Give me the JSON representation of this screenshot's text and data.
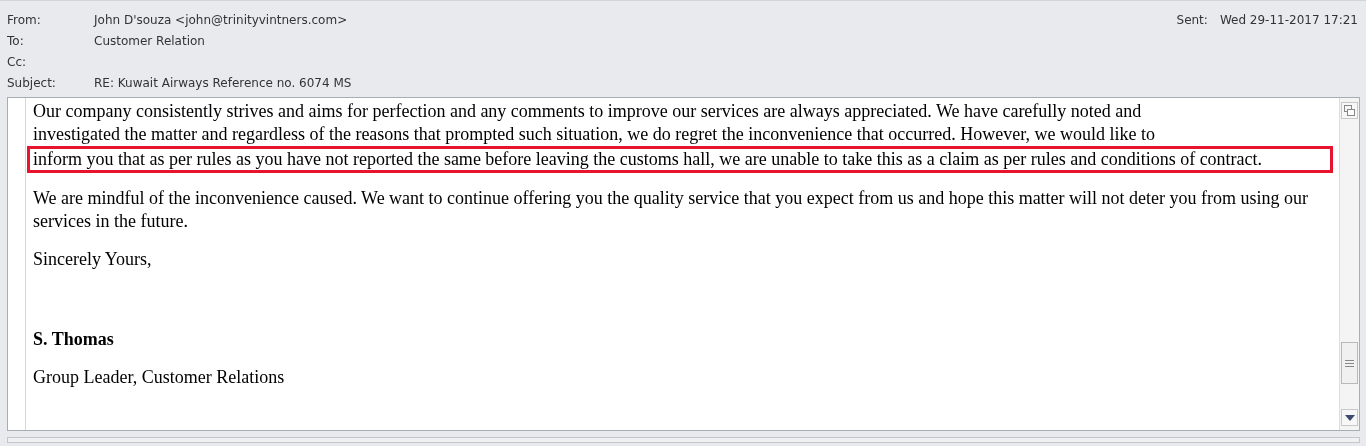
{
  "header": {
    "fields": [
      {
        "label": "From:",
        "value": "John D'souza <john@trinityvintners.com>"
      },
      {
        "label": "To:",
        "value": "Customer Relation"
      },
      {
        "label": "Cc:"
      },
      {
        "label": "Subject:",
        "value": "RE: Kuwait Airways Reference no. 6074 MS"
      }
    ],
    "sent": {
      "label": "Sent:",
      "value": "Wed 29-11-2017 17:21"
    }
  },
  "body": {
    "blocks": [
      {
        "kind": "lines",
        "lines": [
          {
            "text": "Our company consistently strives and aims for perfection and any comments to improve our services are always appreciated. We have carefully noted and",
            "highlighted": false
          },
          {
            "text": "investigated the matter and regardless of the reasons that prompted such situation, we do regret the inconvenience that occurred. However, we would like to",
            "highlighted": false
          },
          {
            "text": "inform you that as per rules as you have not reported the same before leaving the customs hall, we are unable to take this as a claim as per rules and conditions of contract.",
            "highlighted": true
          }
        ]
      },
      {
        "kind": "paragraph",
        "text": "We are mindful of the inconvenience caused. We want to continue offering you the quality service that you expect from us and hope this matter will not deter you from using our services in the future."
      },
      {
        "kind": "paragraph",
        "text": "Sincerely Yours,"
      },
      {
        "kind": "spacer"
      },
      {
        "kind": "signature",
        "text": "S. Thomas"
      },
      {
        "kind": "paragraph",
        "text": "Group Leader, Customer Relations"
      }
    ]
  }
}
